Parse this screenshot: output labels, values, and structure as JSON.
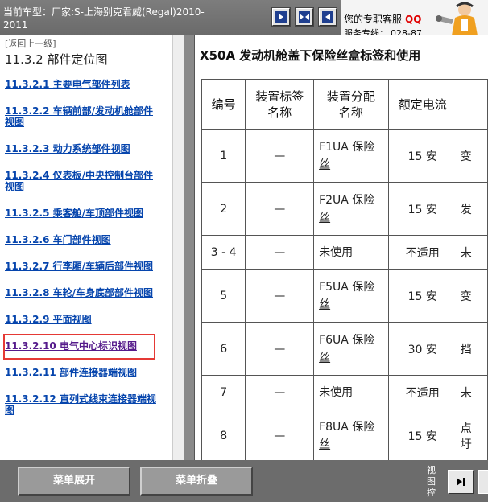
{
  "header": {
    "vehicle_line1": "当前车型：厂家:S-上海别克君威(Regal)2010-",
    "vehicle_line2": "2011",
    "service_label": "您的专职客服",
    "qq": "QQ",
    "hotline_label": "服务专线：",
    "hotline_number": "028-87"
  },
  "left": {
    "back_link": "[返回上一级]",
    "section_title": "11.3.2 部件定位图",
    "links": [
      {
        "line1": "11.3.2.1 主要电气部件列表",
        "line2": ""
      },
      {
        "line1": "11.3.2.2 车辆前部/发动机舱部件",
        "line2": "视图"
      },
      {
        "line1": "11.3.2.3 动力系统部件视图",
        "line2": ""
      },
      {
        "line1": "11.3.2.4 仪表板/中央控制台部件",
        "line2": "视图"
      },
      {
        "line1": "11.3.2.5 乘客舱/车顶部件视图",
        "line2": ""
      },
      {
        "line1": "11.3.2.6 车门部件视图",
        "line2": ""
      },
      {
        "line1": "11.3.2.7 行李厢/车辆后部件视图",
        "line2": ""
      },
      {
        "line1": "11.3.2.8 车轮/车身底部部件视图",
        "line2": ""
      },
      {
        "line1": "11.3.2.9 平面视图",
        "line2": ""
      },
      {
        "line1": "11.3.2.10 电气中心标识视图",
        "line2": ""
      },
      {
        "line1": "11.3.2.11 部件连接器端视图",
        "line2": ""
      },
      {
        "line1": "11.3.2.12 直列式线束连接器端视",
        "line2": "图"
      }
    ]
  },
  "doc": {
    "title": "X50A 发动机舱盖下保险丝盒标签和使用",
    "headers": {
      "no": "编号",
      "label_1": "装置标签",
      "label_2": "名称",
      "name_1": "装置分配",
      "name_2": "名称",
      "rating": "额定电流"
    },
    "rows": [
      {
        "no": "1",
        "label": "—",
        "name_1": "F1UA 保险",
        "name_2": "丝",
        "rating": "15 安",
        "extra": "变"
      },
      {
        "no": "2",
        "label": "—",
        "name_1": "F2UA 保险",
        "name_2": "丝",
        "rating": "15 安",
        "extra": "发"
      },
      {
        "no": "3 - 4",
        "label": "—",
        "name_1": "未使用",
        "name_2": "",
        "rating": "不适用",
        "extra": "未"
      },
      {
        "no": "5",
        "label": "—",
        "name_1": "F5UA 保险",
        "name_2": "丝",
        "rating": "15 安",
        "extra": "变"
      },
      {
        "no": "6",
        "label": "—",
        "name_1": "F6UA 保险",
        "name_2": "丝",
        "rating": "30 安",
        "extra": "挡"
      },
      {
        "no": "7",
        "label": "—",
        "name_1": "未使用",
        "name_2": "",
        "rating": "不适用",
        "extra": "未"
      },
      {
        "no": "8",
        "label": "—",
        "name_1": "F8UA 保险",
        "name_2": "丝",
        "rating": "15 安",
        "extra": "点"
      }
    ],
    "row8_extra2": "圩"
  },
  "footer": {
    "expand_label": "菜单展开",
    "collapse_label": "菜单折叠",
    "view_ctrl": "视图控"
  },
  "colors": {
    "link": "#0645ad",
    "link_visited": "#551a8b",
    "highlight": "#e53935",
    "qq": "#e00000"
  }
}
